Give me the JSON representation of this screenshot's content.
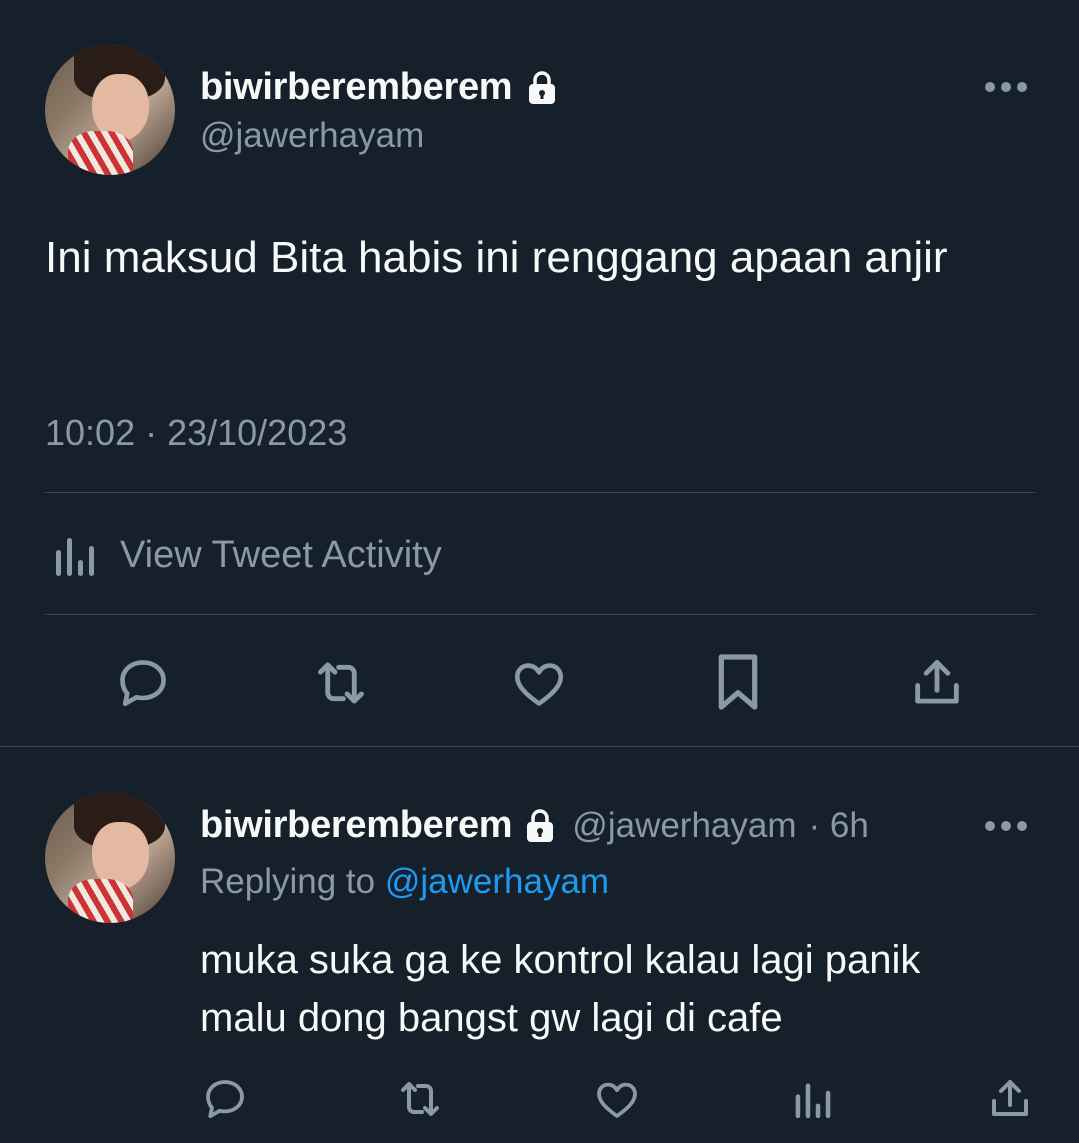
{
  "main_tweet": {
    "display_name": "biwirberemberem",
    "handle": "@jawerhayam",
    "text": "Ini maksud Bita habis ini renggang apaan anjir",
    "timestamp": "10:02 · 23/10/2023",
    "activity_label": "View Tweet Activity",
    "protected": true
  },
  "reply": {
    "display_name": "biwirberemberem",
    "handle": "@jawerhayam",
    "age": "· 6h",
    "replying_prefix": "Replying to",
    "replying_handle": "@jawerhayam",
    "text_line1": "muka suka ga ke kontrol kalau lagi panik",
    "text_line2": "malu dong bangst gw lagi di cafe"
  },
  "colors": {
    "background": "#15202b",
    "text": "#f7f9f9",
    "muted": "#8b98a5",
    "link": "#1d9bf0",
    "divider": "#38444d"
  },
  "icons": [
    "lock-icon",
    "more-icon",
    "analytics-icon",
    "reply-icon",
    "retweet-icon",
    "like-icon",
    "bookmark-icon",
    "share-icon"
  ]
}
